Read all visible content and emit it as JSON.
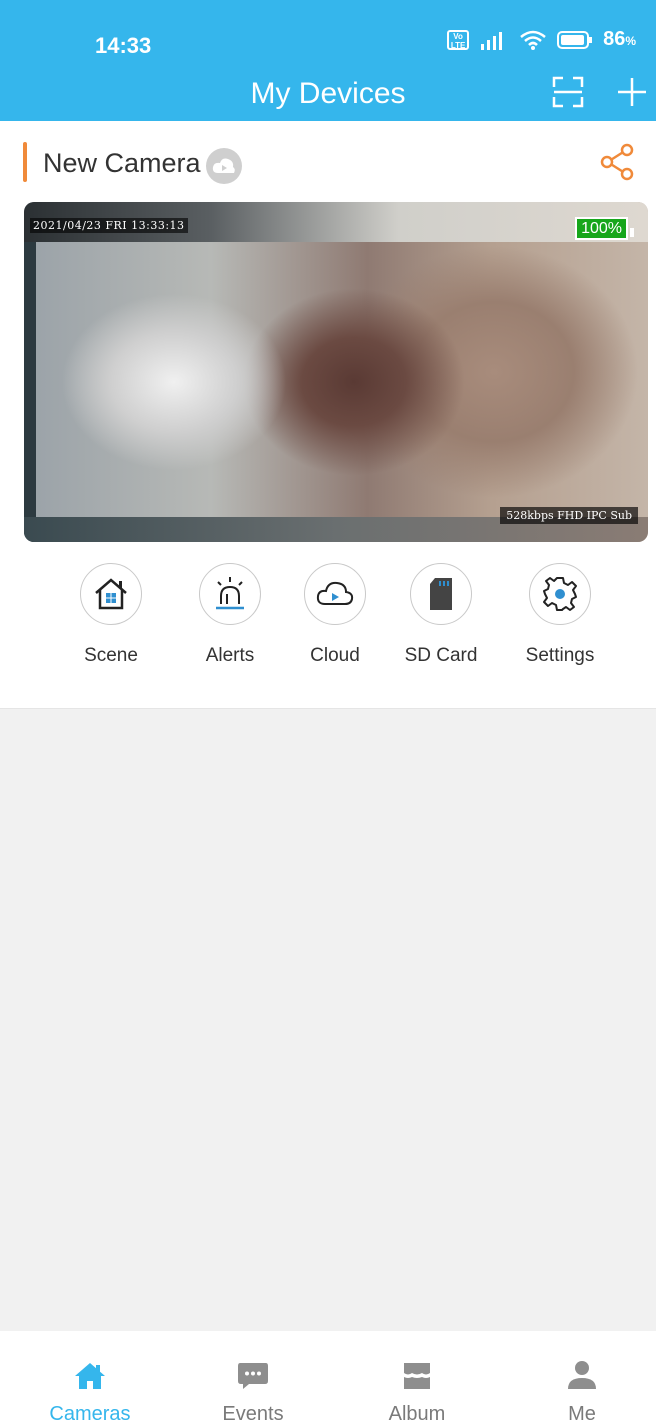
{
  "status": {
    "time": "14:33",
    "battery": "86",
    "battery_unit": "%",
    "volte": "Vo LTE"
  },
  "header": {
    "title": "My Devices"
  },
  "camera": {
    "name": "New Camera",
    "osd_datetime": "2021/04/23  FRI 13:33:13",
    "battery_level": "100%",
    "stream_info": "528kbps FHD IPC Sub"
  },
  "actions": [
    {
      "label": "Scene",
      "icon": "home-icon"
    },
    {
      "label": "Alerts",
      "icon": "alarm-icon"
    },
    {
      "label": "Cloud",
      "icon": "cloud-play-icon"
    },
    {
      "label": "SD Card",
      "icon": "sd-card-icon"
    },
    {
      "label": "Settings",
      "icon": "gear-icon"
    }
  ],
  "tabs": [
    {
      "label": "Cameras",
      "icon": "house-icon",
      "active": true
    },
    {
      "label": "Events",
      "icon": "chat-icon",
      "active": false
    },
    {
      "label": "Album",
      "icon": "album-icon",
      "active": false
    },
    {
      "label": "Me",
      "icon": "person-icon",
      "active": false
    }
  ],
  "colors": {
    "primary": "#35b6ec",
    "accent": "#f08a3a",
    "battery_green": "#17a61b"
  }
}
